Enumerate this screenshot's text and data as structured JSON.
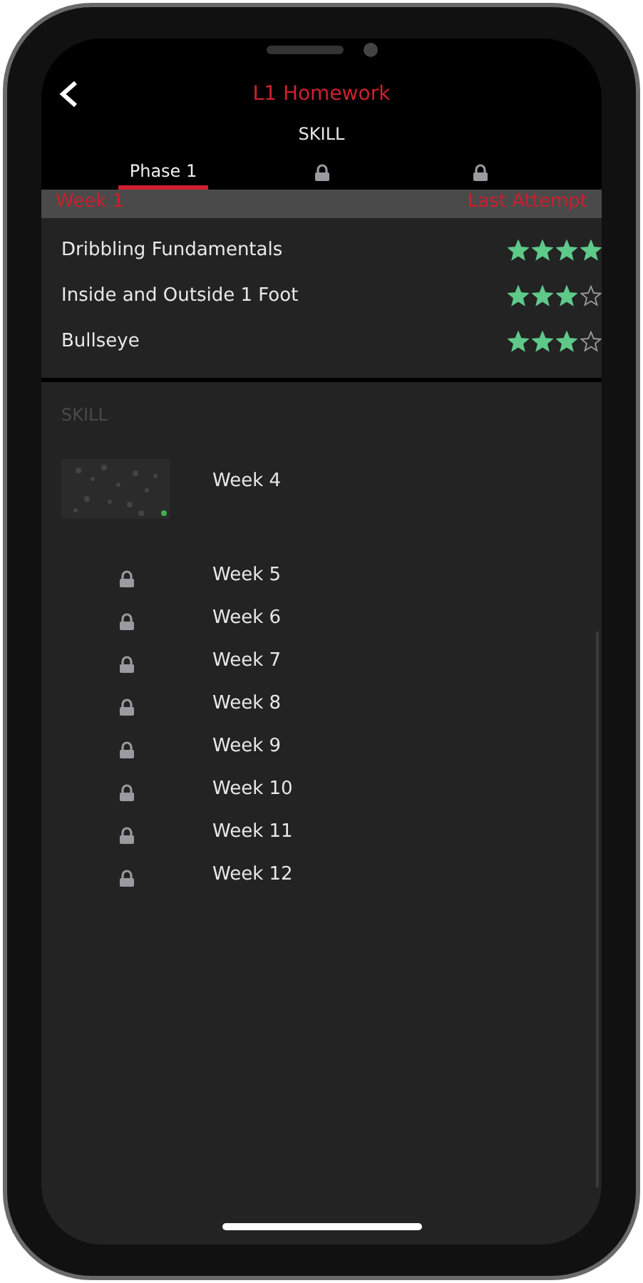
{
  "header": {
    "title": "L1 Homework",
    "subtitle": "SKILL"
  },
  "tabs": [
    {
      "label": "Phase 1",
      "locked": false,
      "selected": true
    },
    {
      "locked": true,
      "selected": false
    },
    {
      "locked": true,
      "selected": false
    }
  ],
  "week_header": {
    "week": "Week 1",
    "column": "Last Attempt"
  },
  "drills": [
    {
      "name": "Dribbling Fundamentals",
      "stars": 4
    },
    {
      "name": "Inside and Outside 1 Foot",
      "stars": 3
    },
    {
      "name": "Bullseye",
      "stars": 3
    }
  ],
  "section": {
    "title": "SKILL"
  },
  "weeks": [
    {
      "label": "Week 4",
      "locked": false
    },
    {
      "label": "Week 5",
      "locked": true
    },
    {
      "label": "Week 6",
      "locked": true
    },
    {
      "label": "Week 7",
      "locked": true
    },
    {
      "label": "Week 8",
      "locked": true
    },
    {
      "label": "Week 9",
      "locked": true
    },
    {
      "label": "Week 10",
      "locked": true
    },
    {
      "label": "Week 11",
      "locked": true
    },
    {
      "label": "Week 12",
      "locked": true
    }
  ]
}
